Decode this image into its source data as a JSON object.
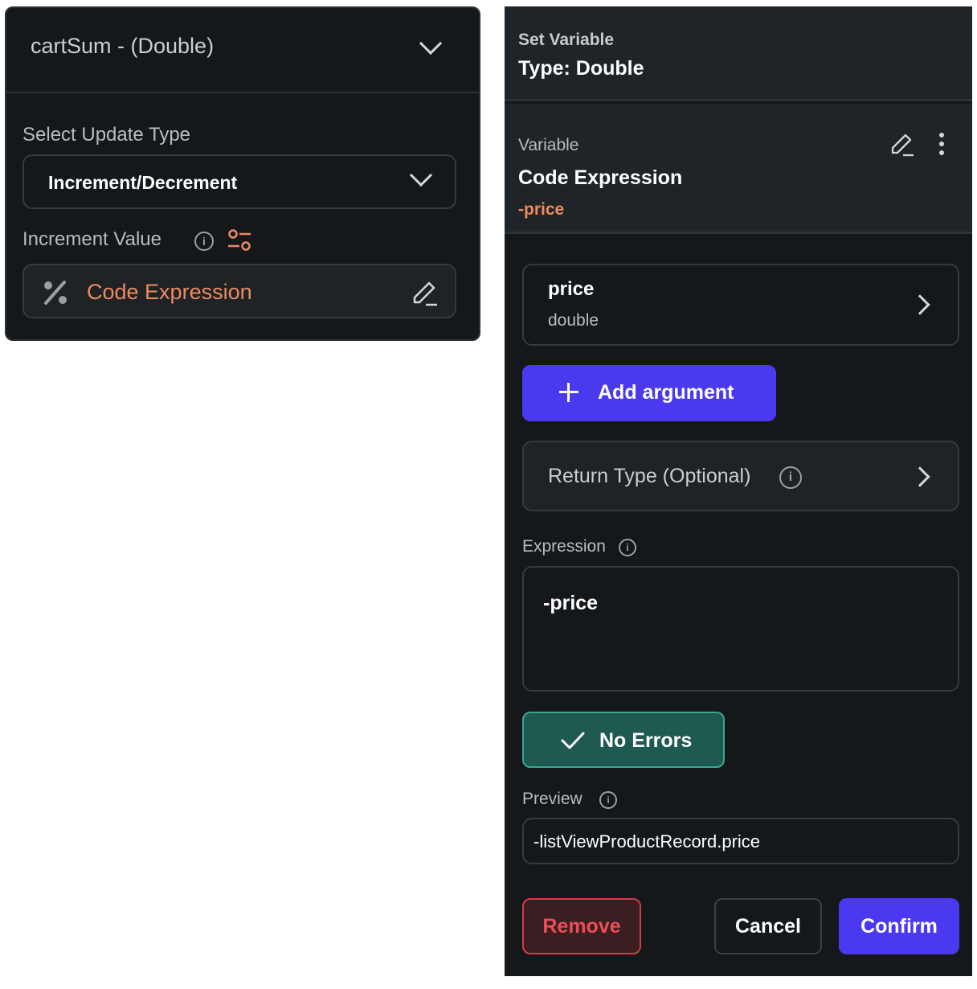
{
  "left": {
    "variable_header": "cartSum - (Double)",
    "update_type_label": "Select Update Type",
    "update_type_value": "Increment/Decrement",
    "increment_label": "Increment Value",
    "increment_value": "Code Expression"
  },
  "right": {
    "set_variable_label": "Set Variable",
    "set_variable_type": "Type: Double",
    "variable_label": "Variable",
    "variable_title": "Code Expression",
    "variable_value": "-price",
    "argument": {
      "name": "price",
      "type": "double"
    },
    "add_argument_label": "Add argument",
    "return_type_label": "Return Type (Optional)",
    "expression_label": "Expression",
    "expression_value": "-price",
    "status_label": "No Errors",
    "preview_label": "Preview",
    "preview_value": "-listViewProductRecord.price",
    "buttons": {
      "remove": "Remove",
      "cancel": "Cancel",
      "confirm": "Confirm"
    }
  },
  "icons": {
    "chevron": "chevron-down-icon",
    "info": "info-icon",
    "tune": "tune-icon",
    "percent": "percent-icon",
    "edit": "pencil-icon",
    "more": "more-vert-icon",
    "arrow": "chevron-right-icon",
    "add": "plus-icon",
    "check": "check-icon"
  },
  "colors": {
    "panel_bg": "#14181b",
    "card_bg": "#1e2428",
    "accent_orange": "#ef8a5f",
    "primary": "#4b39ef",
    "success_bg": "#1f5a51",
    "success_border": "#3aa691",
    "danger": "#ef4d55"
  }
}
